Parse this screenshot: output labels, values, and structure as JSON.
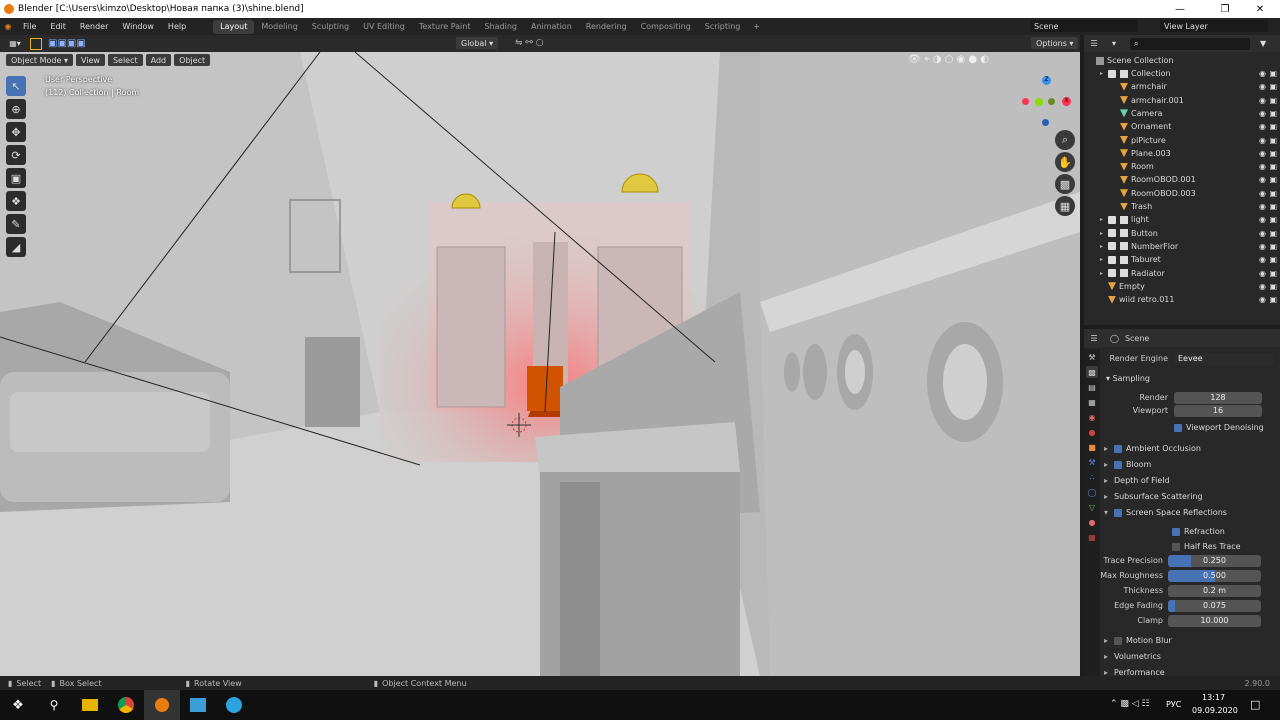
{
  "window": {
    "title": "Blender [C:\\Users\\kimzo\\Desktop\\Новая папка (3)\\shine.blend]"
  },
  "menu": [
    "File",
    "Edit",
    "Render",
    "Window",
    "Help"
  ],
  "workspaces": [
    "Layout",
    "Modeling",
    "Sculpting",
    "UV Editing",
    "Texture Paint",
    "Shading",
    "Animation",
    "Rendering",
    "Compositing",
    "Scripting"
  ],
  "active_workspace": "Layout",
  "scene_field": "Scene",
  "view_layer_field": "View Layer",
  "viewport_header": {
    "mode": "Object Mode",
    "menus": [
      "View",
      "Select",
      "Add",
      "Object"
    ],
    "transform_orientation": "Global",
    "options": "Options"
  },
  "viewport_overlay": {
    "line1": "User Perspective",
    "line2": "(112) Collection | Room"
  },
  "gizmo": {
    "x": "X",
    "y": "Y",
    "z": "Z"
  },
  "outliner": {
    "title": "Scene Collection",
    "items": [
      {
        "label": "Collection",
        "indent": 1,
        "kind": "collection"
      },
      {
        "label": "armchair",
        "indent": 2,
        "kind": "mesh"
      },
      {
        "label": "armchair.001",
        "indent": 2,
        "kind": "mesh"
      },
      {
        "label": "Camera",
        "indent": 2,
        "kind": "camera"
      },
      {
        "label": "Ornament",
        "indent": 2,
        "kind": "mesh"
      },
      {
        "label": "plPicture",
        "indent": 2,
        "kind": "mesh"
      },
      {
        "label": "Plane.003",
        "indent": 2,
        "kind": "mesh"
      },
      {
        "label": "Room",
        "indent": 2,
        "kind": "mesh"
      },
      {
        "label": "RoomOBOD.001",
        "indent": 2,
        "kind": "mesh"
      },
      {
        "label": "RoomOBOD.003",
        "indent": 2,
        "kind": "mesh"
      },
      {
        "label": "Trash",
        "indent": 2,
        "kind": "mesh"
      },
      {
        "label": "light",
        "indent": 1,
        "kind": "collection"
      },
      {
        "label": "Button",
        "indent": 1,
        "kind": "collection"
      },
      {
        "label": "NumberFlor",
        "indent": 1,
        "kind": "collection"
      },
      {
        "label": "Taburet",
        "indent": 1,
        "kind": "collection"
      },
      {
        "label": "Radiator",
        "indent": 1,
        "kind": "collection"
      },
      {
        "label": "Empty",
        "indent": 1,
        "kind": "empty"
      },
      {
        "label": "wiid retro.011",
        "indent": 1,
        "kind": "mesh"
      }
    ]
  },
  "properties": {
    "tab": "Scene",
    "render_engine_label": "Render Engine",
    "render_engine": "Eevee",
    "sampling": {
      "title": "Sampling",
      "render_label": "Render",
      "render": "128",
      "viewport_label": "Viewport",
      "viewport": "16",
      "denoise": "Viewport Denoising"
    },
    "panels": [
      "Ambient Occlusion",
      "Bloom",
      "Depth of Field",
      "Subsurface Scattering",
      "Screen Space Reflections"
    ],
    "ssr": {
      "refraction": "Refraction",
      "half_res": "Half Res Trace",
      "trace_precision_label": "Trace Precision",
      "trace_precision": "0.250",
      "trace_precision_frac": 0.25,
      "max_roughness_label": "Max Roughness",
      "max_roughness": "0.500",
      "max_roughness_frac": 0.5,
      "thickness_label": "Thickness",
      "thickness": "0.2 m",
      "edge_fading_label": "Edge Fading",
      "edge_fading": "0.075",
      "edge_fading_frac": 0.075,
      "clamp_label": "Clamp",
      "clamp": "10.000"
    },
    "more_panels": [
      "Motion Blur",
      "Volumetrics",
      "Performance"
    ]
  },
  "status": {
    "select": "Select",
    "box_select": "Box Select",
    "rotate": "Rotate View",
    "context": "Object Context Menu",
    "version": "2.90.0"
  },
  "taskbar": {
    "lang": "РУС",
    "time": "13:17",
    "date": "09.09.2020"
  }
}
